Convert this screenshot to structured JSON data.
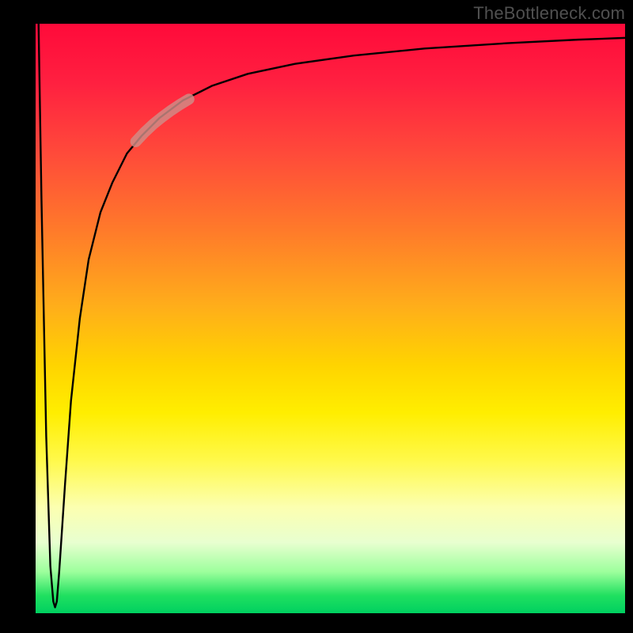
{
  "attribution": "TheBottleneck.com",
  "colors": {
    "background_frame": "#000000",
    "curve_stroke": "#000000",
    "highlight_stroke": "#cf8d87",
    "gradient_top": "#ff0a3a",
    "gradient_mid": "#ffd400",
    "gradient_bottom": "#00d060",
    "attribution_text": "#505050"
  },
  "chart_data": {
    "type": "line",
    "title": "",
    "xlabel": "",
    "ylabel": "",
    "xlim": [
      0,
      100
    ],
    "ylim": [
      0,
      100
    ],
    "grid": false,
    "description": "Bottleneck percentage curve. Vertical axis is % bottleneck (0 = green/good at bottom, 100 = red/bad at top). Curve plunges from ~100% to ~0% over a very narrow x-range then climbs back and asymptotically approaches ~97–98% as x → 100.",
    "series": [
      {
        "name": "bottleneck-curve",
        "x": [
          0.5,
          1.0,
          1.8,
          2.5,
          3.0,
          3.3,
          3.6,
          4.0,
          5.0,
          6.0,
          7.5,
          9.0,
          11.0,
          13.0,
          15.5,
          18.0,
          21.0,
          25.0,
          30.0,
          36.0,
          44.0,
          54.0,
          66.0,
          80.0,
          92.0,
          100.0
        ],
        "y": [
          100,
          70,
          30,
          8,
          2,
          1,
          2,
          7,
          22,
          36,
          50,
          60,
          68,
          73,
          78,
          81,
          84,
          87,
          89.5,
          91.5,
          93.2,
          94.6,
          95.8,
          96.7,
          97.3,
          97.6
        ]
      }
    ],
    "highlight": {
      "name": "highlight-segment",
      "x": [
        17.0,
        18.5,
        20.0,
        21.5,
        23.0,
        24.5,
        26.0
      ],
      "y": [
        80.0,
        81.6,
        83.0,
        84.2,
        85.3,
        86.3,
        87.2
      ]
    }
  }
}
